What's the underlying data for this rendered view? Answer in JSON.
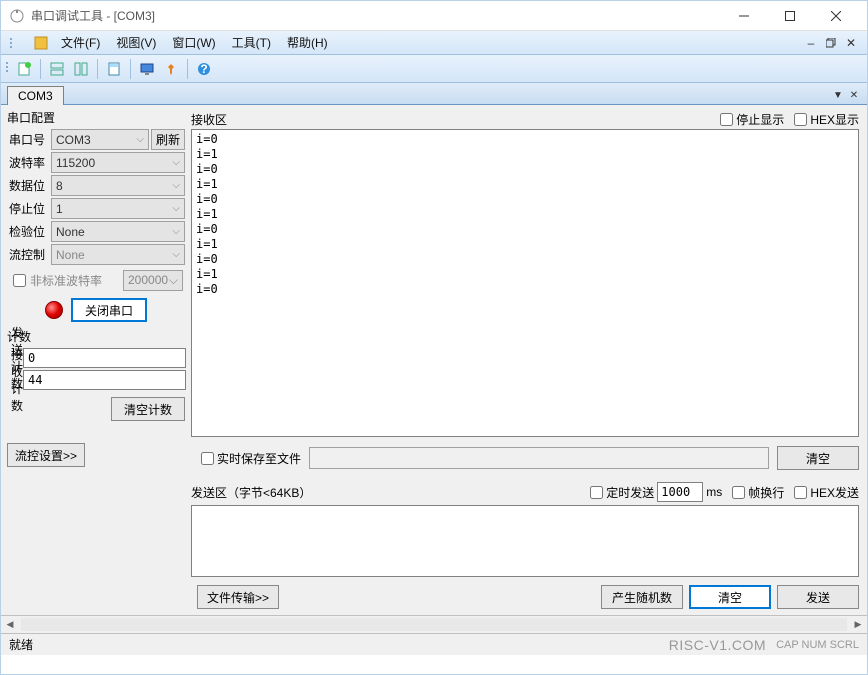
{
  "window": {
    "title": "串口调试工具 - [COM3]"
  },
  "menu": {
    "file": "文件(F)",
    "view": "视图(V)",
    "window": "窗口(W)",
    "tools": "工具(T)",
    "help": "帮助(H)"
  },
  "tab": {
    "label": "COM3"
  },
  "serial": {
    "group_title": "串口配置",
    "port_label": "串口号",
    "port_value": "COM3",
    "refresh": "刷新",
    "baud_label": "波特率",
    "baud_value": "115200",
    "data_label": "数据位",
    "data_value": "8",
    "stop_label": "停止位",
    "stop_value": "1",
    "parity_label": "检验位",
    "parity_value": "None",
    "flow_label": "流控制",
    "flow_value": "None",
    "nonstd_label": "非标准波特率",
    "nonstd_value": "200000",
    "close_port": "关闭串口"
  },
  "count": {
    "title": "计数",
    "send_label": "发送计数",
    "send_value": "0",
    "recv_label": "接收计数",
    "recv_value": "44",
    "clear": "清空计数"
  },
  "flow_settings": "流控设置>>",
  "recv": {
    "title": "接收区",
    "stop_display": "停止显示",
    "hex_display": "HEX显示",
    "content": "i=0\ni=1\ni=0\ni=1\ni=0\ni=1\ni=0\ni=1\ni=0\ni=1\ni=0"
  },
  "save": {
    "realtime": "实时保存至文件",
    "clear": "清空"
  },
  "send": {
    "title": "发送区（字节<64KB）",
    "timed": "定时发送",
    "interval": "1000",
    "ms": "ms",
    "frame_wrap": "帧换行",
    "hex_send": "HEX发送",
    "file_transfer": "文件传输>>",
    "gen_random": "产生随机数",
    "clear": "清空",
    "send_btn": "发送"
  },
  "status": {
    "ready": "就绪",
    "watermark": "RISC-V1.COM",
    "caps": "CAP  NUM  SCRL"
  }
}
